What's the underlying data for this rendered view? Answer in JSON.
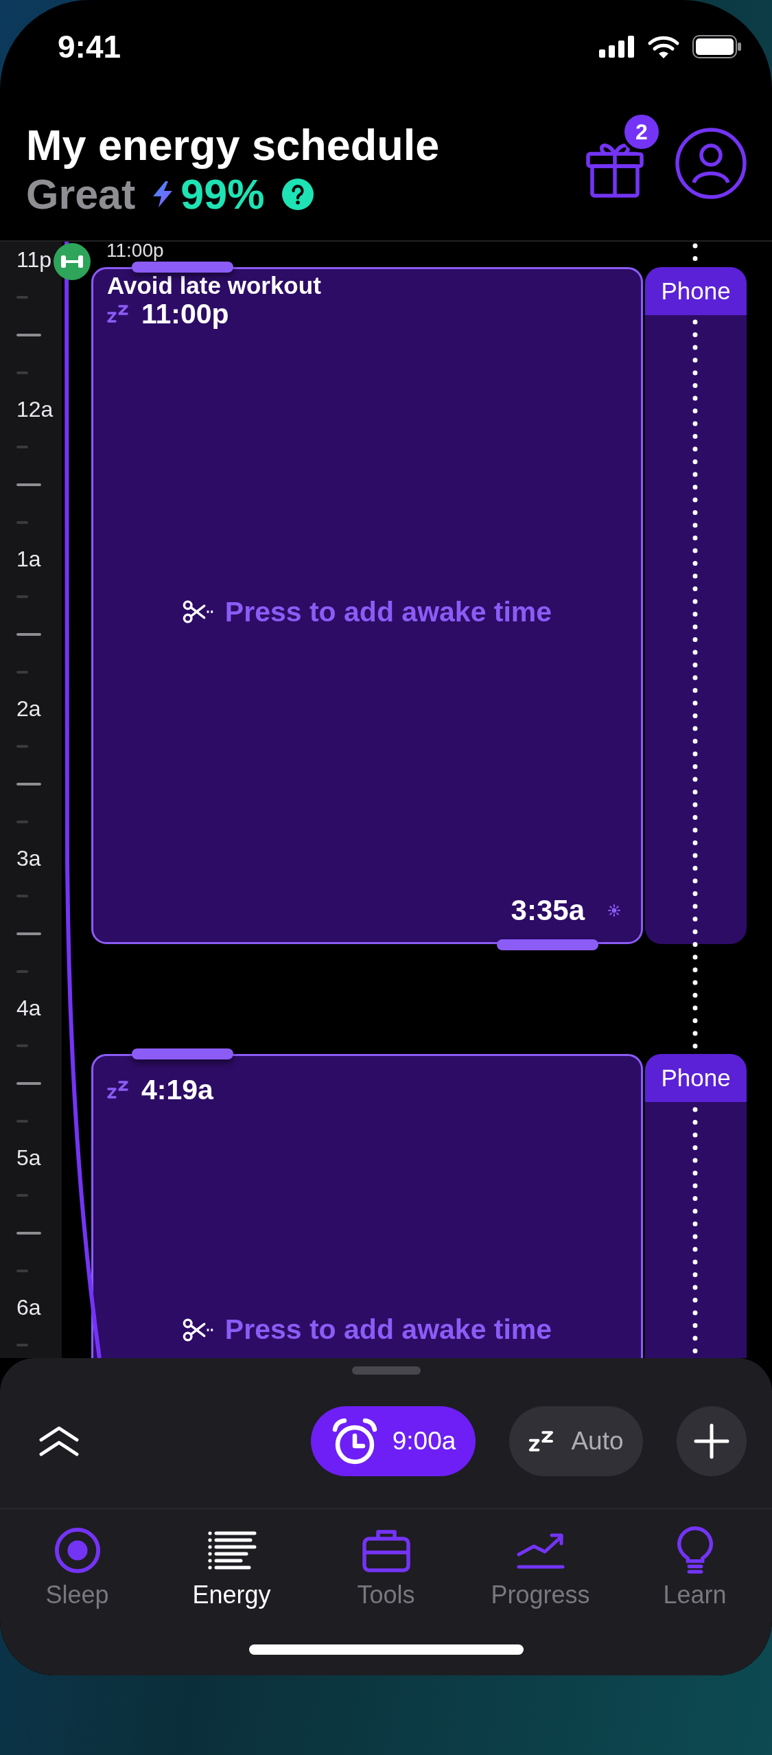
{
  "status_bar": {
    "time": "9:41"
  },
  "header": {
    "title": "My energy schedule",
    "rating": "Great",
    "score": "99%",
    "gift_badge": "2"
  },
  "timeline": {
    "hour_labels": [
      "11p",
      "12a",
      "1a",
      "2a",
      "3a",
      "4a",
      "5a",
      "6a"
    ],
    "marker_time": "11:00p",
    "blocks": [
      {
        "event": "Avoid late workout",
        "start": "11:00p",
        "action": "Press to add awake time",
        "end": "3:35a",
        "side_label": "Phone"
      },
      {
        "start": "4:19a",
        "action": "Press to add awake time",
        "side_label": "Phone"
      }
    ]
  },
  "controls": {
    "alarm_time": "9:00a",
    "sleep_mode": "Auto"
  },
  "tabs": [
    {
      "label": "Sleep",
      "selected": false
    },
    {
      "label": "Energy",
      "selected": true
    },
    {
      "label": "Tools",
      "selected": false
    },
    {
      "label": "Progress",
      "selected": false
    },
    {
      "label": "Learn",
      "selected": false
    }
  ]
}
